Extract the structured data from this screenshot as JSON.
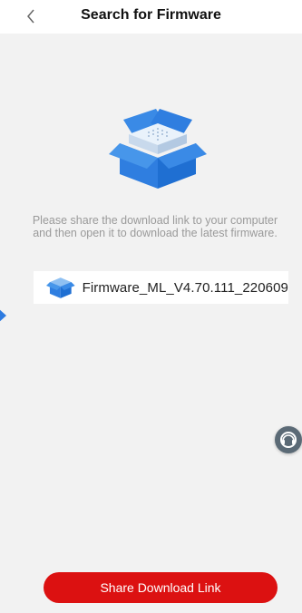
{
  "header": {
    "title": "Search for Firmware",
    "back_icon": "chevron-left-icon"
  },
  "main": {
    "hero_icon": "firmware-box-icon",
    "description": "Please share the download link to your computer and then open it to download the latest firmware.",
    "file": {
      "icon": "firmware-box-icon",
      "name": "Firmware_ML_V4.70.111_220609"
    }
  },
  "floating": {
    "icon": "support-headset-icon"
  },
  "footer": {
    "share_label": "Share Download Link"
  },
  "colors": {
    "accent": "#dc1111",
    "background": "#f2f2f2",
    "box_blue": "#2f7ee0"
  }
}
